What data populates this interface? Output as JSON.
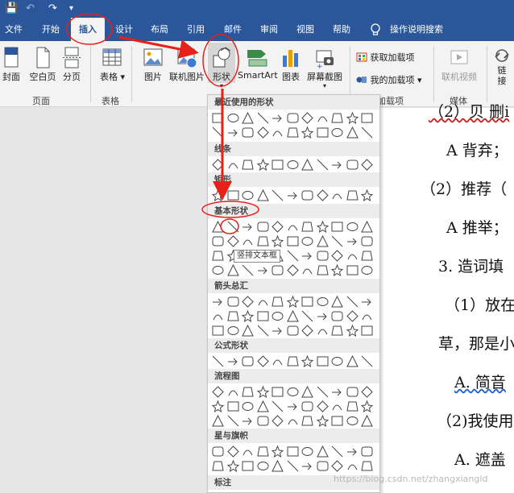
{
  "quick_access": {
    "save": "💾",
    "undo": "↶",
    "redo": "↷",
    "more": "▾"
  },
  "tabs": [
    "文件",
    "开始",
    "插入",
    "设计",
    "布局",
    "引用",
    "邮件",
    "审阅",
    "视图",
    "帮助"
  ],
  "active_tab_index": 2,
  "tell_me": "操作说明搜索",
  "ribbon": {
    "pages": {
      "cover": "封面",
      "blank": "空白页",
      "break": "分页",
      "group": "页面"
    },
    "tables": {
      "table": "表格",
      "group": "表格"
    },
    "illustrations": {
      "picture": "图片",
      "online_picture": "联机图片",
      "shapes": "形状",
      "smartart": "SmartArt",
      "chart": "图表",
      "screenshot": "屏幕截图"
    },
    "addins": {
      "get": "获取加载项",
      "mine": "我的加载项",
      "group": "加载项"
    },
    "media": {
      "online_video": "联机视频",
      "group": "媒体"
    },
    "links": {
      "link_1": "链",
      "link_2": "接"
    }
  },
  "dropdown": {
    "sections": {
      "recent": "最近使用的形状",
      "lines": "线条",
      "rectangles": "矩形",
      "basic": "基本形状",
      "arrows": "箭头总汇",
      "equation": "公式形状",
      "flowchart": "流程图",
      "stars": "星与旗帜",
      "callouts": "标注"
    },
    "tooltip": "竖排文本框"
  },
  "document_lines": [
    "（2）贝 删i",
    "A 背弃；",
    "（2）推荐（",
    "A 推举；",
    "3.   造词填",
    "（1）放在",
    "草，那是小",
    "A. 简音",
    "（2)我使用",
    "A. 遮盖"
  ],
  "watermark": "https://blog.csdn.net/zhangxiangld"
}
